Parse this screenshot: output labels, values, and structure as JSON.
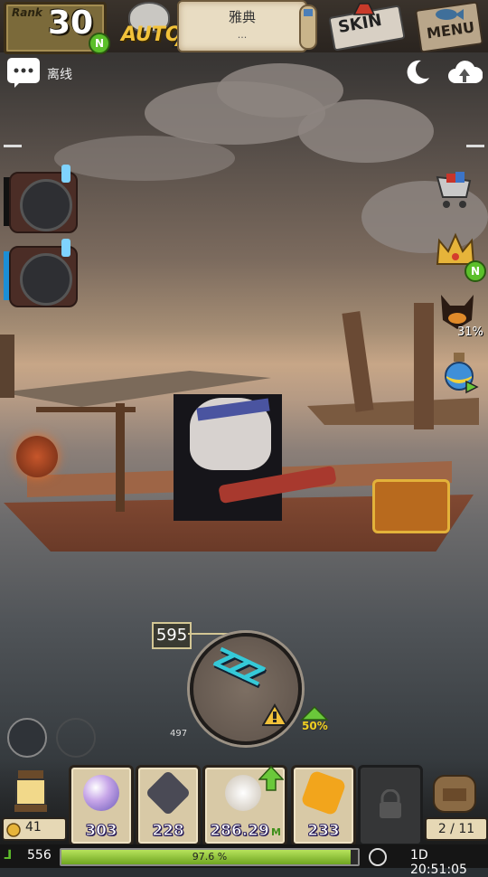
{
  "topbar": {
    "rank_label": "Rank",
    "rank_value": "30",
    "rank_badge": "N",
    "auto_label": "AUTO",
    "location_title": "雅典",
    "location_subtitle": "...",
    "skin_label": "SKIN",
    "menu_label": "MENU"
  },
  "status": {
    "offline_text": "离线"
  },
  "right_panel": {
    "crown_badge": "N",
    "pet_percent": "31%"
  },
  "dial": {
    "max_value": "595",
    "min_value": "497",
    "sleep_text": "ZZZ",
    "boost_text": "50%"
  },
  "inventory": {
    "lamp_count": "41",
    "slots": [
      {
        "value": "303",
        "icon": "pearl-orb-icon",
        "color": "#b49ad8"
      },
      {
        "value": "228",
        "icon": "dark-gem-icon",
        "color": "#4a4a55"
      },
      {
        "value": "286.29",
        "icon": "shell-icon",
        "color": "#e8e2d6",
        "arrow": true,
        "suffix": "M"
      },
      {
        "value": "233",
        "icon": "gold-ore-icon",
        "color": "#f2a51c"
      }
    ],
    "bag_count": "2 / 11"
  },
  "expbar": {
    "level": "556",
    "exp_percent_text": "97.6 %",
    "exp_fraction": 0.976,
    "time": "1D 20:51:05"
  }
}
